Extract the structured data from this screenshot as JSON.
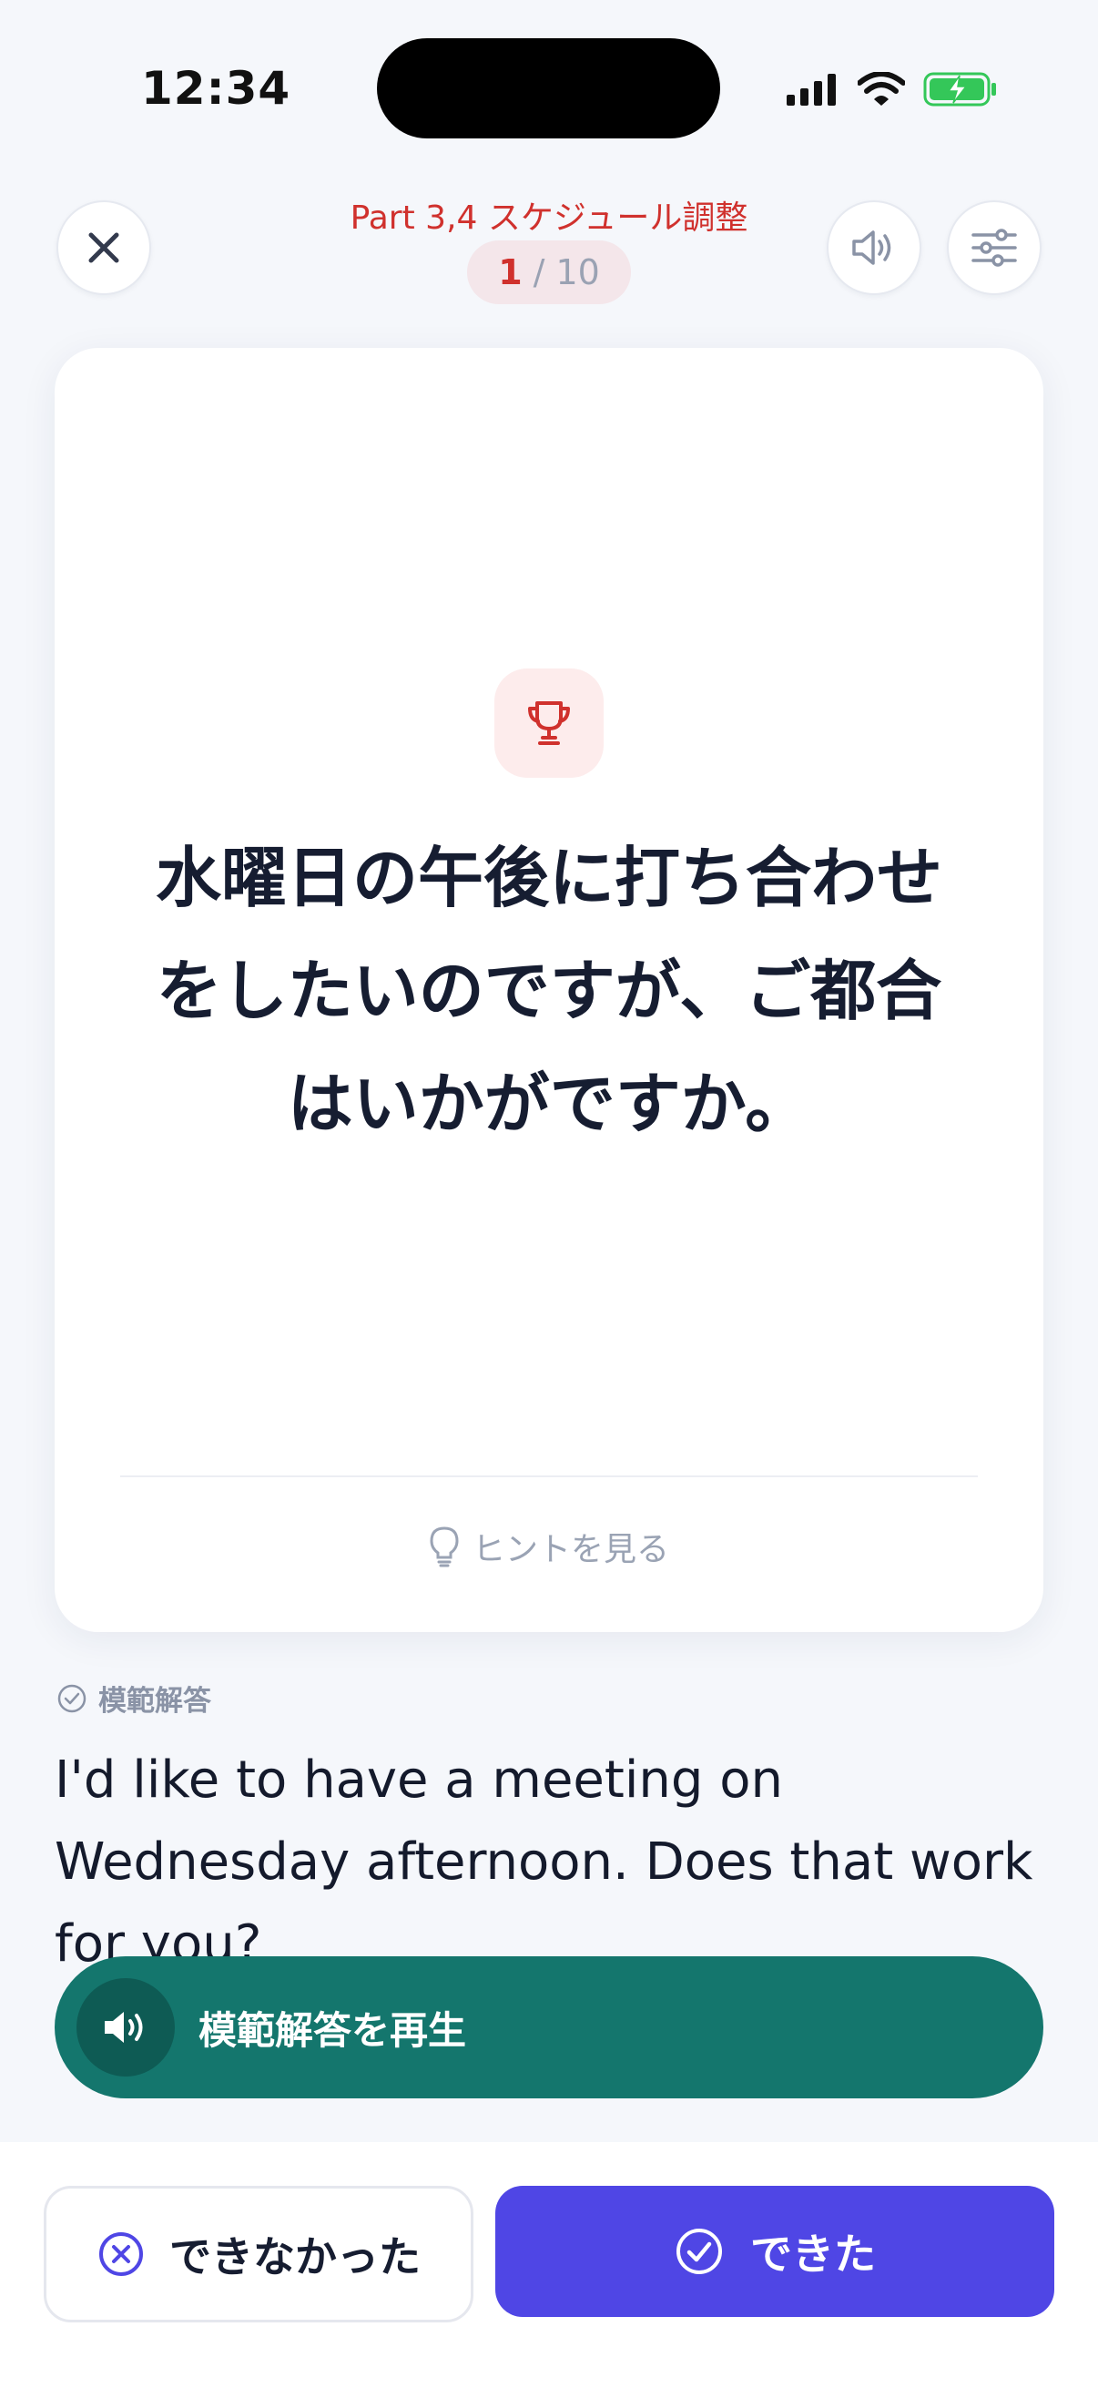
{
  "status_bar": {
    "time": "12:34",
    "icons": [
      "cellular-signal-icon",
      "wifi-icon",
      "battery-charging-icon"
    ],
    "battery_color": "#34c759"
  },
  "header": {
    "deck_title": "Part 3,4 スケジュール調整",
    "progress": {
      "current": "1",
      "separator": "/",
      "total": "10"
    },
    "close_icon": "close-icon",
    "sound_icon": "speaker-icon",
    "settings_icon": "sliders-icon"
  },
  "card": {
    "badge_icon": "trophy-icon",
    "prompt": "水曜日の午後に打ち合わせをしたいのですが、ご都合はいかがですか。",
    "hint_label": "ヒントを見る",
    "hint_icon": "lightbulb-icon"
  },
  "answer": {
    "label": "模範解答",
    "label_icon": "check-circle-icon",
    "text": "I'd like to have a meeting on Wednesday afternoon. Does that work for you?",
    "play_label": "模範解答を再生",
    "play_icon": "speaker-wave-icon"
  },
  "actions": {
    "fail_label": "できなかった",
    "fail_icon": "x-circle-icon",
    "ok_label": "できた",
    "ok_icon": "check-circle-icon"
  },
  "colors": {
    "accent_red": "#d0312d",
    "play_green": "#14766d",
    "primary_indigo": "#4f46e5",
    "background": "#f5f7fb"
  }
}
